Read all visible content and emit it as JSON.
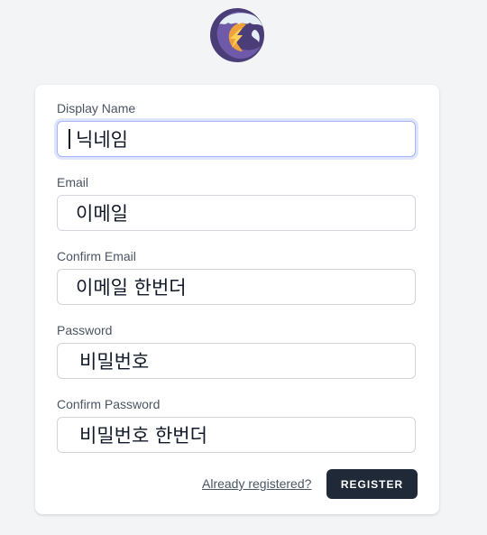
{
  "logo": {
    "icon": "app-logo-icon",
    "colors": {
      "purple": "#5b4a8c",
      "orange": "#f0a23a",
      "snow": "#e8eef5"
    }
  },
  "form": {
    "display_name": {
      "label": "Display Name",
      "value": "닉네임",
      "focused": true
    },
    "email": {
      "label": "Email",
      "value": "이메일"
    },
    "confirm_email": {
      "label": "Confirm Email",
      "value": "이메일 한번더"
    },
    "password": {
      "label": "Password",
      "value": "비밀번호"
    },
    "confirm_password": {
      "label": "Confirm Password",
      "value": "비밀번호 한번더"
    }
  },
  "actions": {
    "already_registered": "Already registered?",
    "register": "REGISTER"
  },
  "colors": {
    "background": "#f3f4f6",
    "card": "#ffffff",
    "button": "#1f2937",
    "focus_ring": "#a5b4fc"
  }
}
